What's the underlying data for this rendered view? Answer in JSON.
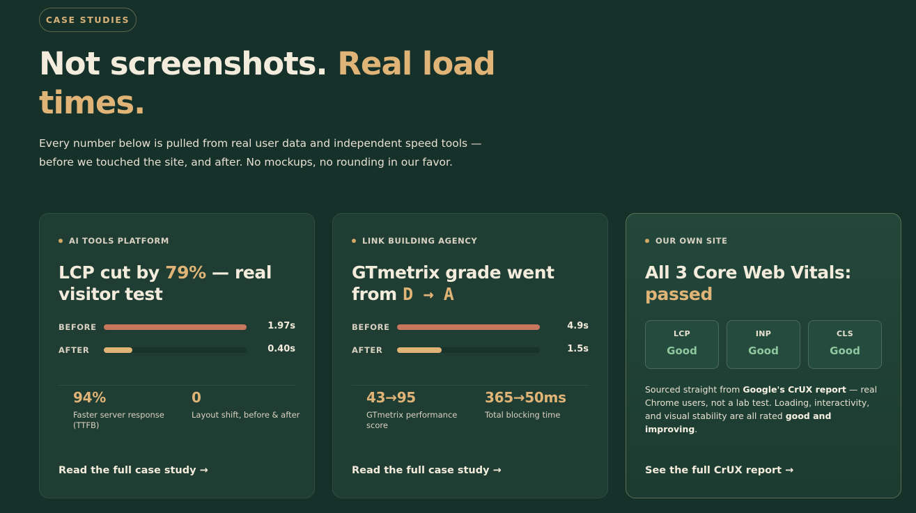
{
  "header": {
    "badge": "CASE STUDIES",
    "title_lead": "Not screenshots.",
    "title_accent": "Real load times.",
    "intro": "Every number below is pulled from real user data and independent speed tools — before we touched the site, and after. No mockups, no rounding in our favor."
  },
  "cards": [
    {
      "tag": "AI TOOLS PLATFORM",
      "title_lead": "LCP cut by",
      "title_accent": "79%",
      "title_tail": "— real visitor test",
      "bars": [
        {
          "label": "BEFORE",
          "value": "1.97s",
          "fraction": 1.0
        },
        {
          "label": "AFTER",
          "value": "0.40s",
          "fraction": 0.2
        }
      ],
      "stats": [
        {
          "value": "94%",
          "desc": "Faster server response (TTFB)"
        },
        {
          "value": "0",
          "desc": "Layout shift, before & after"
        }
      ],
      "link": "Read the full case study →"
    },
    {
      "tag": "LINK BUILDING AGENCY",
      "title_lead": "GTmetrix grade went from",
      "title_mono": "D → A",
      "bars": [
        {
          "label": "BEFORE",
          "value": "4.9s",
          "fraction": 1.0
        },
        {
          "label": "AFTER",
          "value": "1.5s",
          "fraction": 0.31
        }
      ],
      "stats": [
        {
          "value": "43→95",
          "desc": "GTmetrix performance score"
        },
        {
          "value": "365→50ms",
          "desc": "Total blocking time"
        }
      ],
      "link": "Read the full case study →"
    },
    {
      "tag": "OUR OWN SITE",
      "title_lead": "All 3 Core Web Vitals:",
      "title_accent": "passed",
      "vitals": [
        {
          "name": "LCP",
          "status": "Good"
        },
        {
          "name": "INP",
          "status": "Good"
        },
        {
          "name": "CLS",
          "status": "Good"
        }
      ],
      "note_pre": "Sourced straight from",
      "note_strong1": "Google's CrUX report",
      "note_mid": "— real Chrome users, not a lab test. Loading, interactivity, and visual stability are all rated",
      "note_strong2": "good and improving",
      "note_end": ".",
      "link": "See the full CrUX report →"
    }
  ],
  "colors": {
    "background": "#16302a",
    "card": "#1f3d33",
    "accent": "#e0b477",
    "before_bar": "#c8765e",
    "good": "#8fc79f"
  }
}
